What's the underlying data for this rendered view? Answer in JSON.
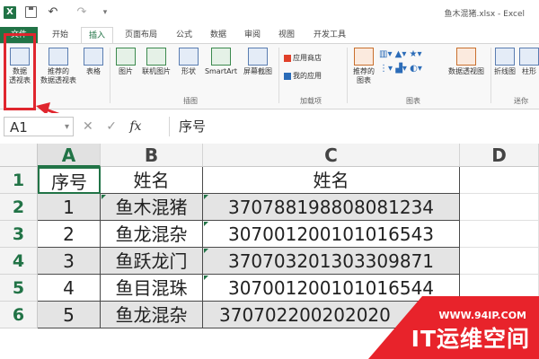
{
  "window": {
    "title": "鱼木混猪.xlsx - Excel"
  },
  "quick_access": {
    "logo": "X",
    "undo": "↶",
    "redo": "↷",
    "more": "▾"
  },
  "tabs": [
    {
      "label": "文件"
    },
    {
      "label": "开始"
    },
    {
      "label": "插入"
    },
    {
      "label": "页面布局"
    },
    {
      "label": "公式"
    },
    {
      "label": "数据"
    },
    {
      "label": "审阅"
    },
    {
      "label": "视图"
    },
    {
      "label": "开发工具"
    }
  ],
  "active_tab": "插入",
  "ribbon": {
    "pivot_table": "数据\n透视表",
    "recommended_pivot": "推荐的\n数据透视表",
    "table": "表格",
    "picture": "图片",
    "online_picture": "联机图片",
    "shapes": "形状",
    "smartart": "SmartArt",
    "screenshot": "屏幕截图",
    "app_store": "应用商店",
    "my_apps": "我的应用",
    "recommended_charts": "推荐的\n图表",
    "pivot_chart": "数据透视图",
    "line": "折线图",
    "column": "柱形",
    "groups": {
      "illustrations": "插图",
      "addins": "加载项",
      "charts": "图表",
      "sparklines": "迷你"
    }
  },
  "formula_bar": {
    "name_box": "A1",
    "cancel": "✕",
    "enter": "✓",
    "fx": "fx",
    "content": "序号"
  },
  "sheet": {
    "columns": [
      "A",
      "B",
      "C",
      "D"
    ],
    "row_numbers": [
      "1",
      "2",
      "3",
      "4",
      "5",
      "6"
    ],
    "rows": [
      [
        "序号",
        "姓名",
        "姓名"
      ],
      [
        "1",
        "鱼木混猪",
        "370788198808081234"
      ],
      [
        "2",
        "鱼龙混杂",
        "307001200101016543"
      ],
      [
        "3",
        "鱼跃龙门",
        "370703201303309871"
      ],
      [
        "4",
        "鱼目混珠",
        "307001200101016544"
      ],
      [
        "5",
        "鱼龙混杂",
        "370702200202020"
      ]
    ]
  },
  "watermark": {
    "url": "WWW.94IP.COM",
    "text": "IT运维空间"
  },
  "colors": {
    "excel_green": "#217346",
    "highlight_red": "#e0262e",
    "watermark_red": "#e8232b"
  }
}
